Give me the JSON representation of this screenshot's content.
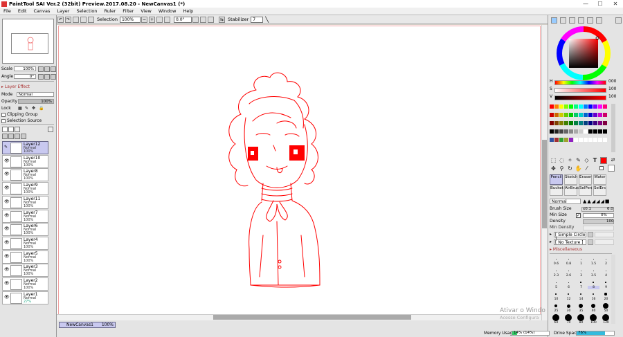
{
  "window": {
    "title": "PaintTool SAI Ver.2 (32bit) Preview.2017.08.20 - NewCanvas1 (*)",
    "minimize_glyph": "—",
    "maximize_glyph": "☐",
    "close_glyph": "✕"
  },
  "menu": [
    "File",
    "Edit",
    "Canvas",
    "Layer",
    "Selection",
    "Ruler",
    "Filter",
    "View",
    "Window",
    "Help"
  ],
  "toolbar": {
    "selection_label": "Selection",
    "zoom_value": "100%",
    "rotation_value": "0.0°",
    "stabilizer_label": "Stabilizer",
    "stabilizer_value": "7"
  },
  "left": {
    "scale_label": "Scale",
    "scale_value": "100%",
    "angle_label": "Angle",
    "angle_value": "0°",
    "layer_effect_label": "Layer Effect",
    "mode_label": "Mode",
    "mode_value": "Normal",
    "opacity_label": "Opacity",
    "opacity_value": "100%",
    "lock_label": "Lock",
    "clipping_label": "Clipping Group",
    "selection_source_label": "Selection Source",
    "layers": [
      {
        "name": "Layer12",
        "mode": "Normal",
        "opacity": "100%",
        "selected": true,
        "visible": false
      },
      {
        "name": "Layer10",
        "mode": "Normal",
        "opacity": "100%",
        "selected": false,
        "visible": true
      },
      {
        "name": "Layer8",
        "mode": "Normal",
        "opacity": "100%",
        "selected": false,
        "visible": true
      },
      {
        "name": "Layer9",
        "mode": "Normal",
        "opacity": "100%",
        "selected": false,
        "visible": true
      },
      {
        "name": "Layer11",
        "mode": "Normal",
        "opacity": "100%",
        "selected": false,
        "visible": true
      },
      {
        "name": "Layer7",
        "mode": "Normal",
        "opacity": "100%",
        "selected": false,
        "visible": true
      },
      {
        "name": "Layer6",
        "mode": "Normal",
        "opacity": "100%",
        "selected": false,
        "visible": true
      },
      {
        "name": "Layer4",
        "mode": "Normal",
        "opacity": "100%",
        "selected": false,
        "visible": true
      },
      {
        "name": "Layer5",
        "mode": "Normal",
        "opacity": "100%",
        "selected": false,
        "visible": true
      },
      {
        "name": "Layer3",
        "mode": "Normal",
        "opacity": "100%",
        "selected": false,
        "visible": true
      },
      {
        "name": "Layer2",
        "mode": "Normal",
        "opacity": "100%",
        "selected": false,
        "visible": true
      },
      {
        "name": "Layer1",
        "mode": "Normal",
        "opacity": "27%",
        "selected": false,
        "visible": true
      }
    ]
  },
  "document_tab": {
    "name": "NewCanvas1",
    "zoom": "100%"
  },
  "color": {
    "current": "#ff0000",
    "h_label": "H",
    "h_value": "000",
    "s_label": "S",
    "s_value": "100",
    "v_label": "V",
    "v_value": "100",
    "swatches": [
      "#ff0000",
      "#ff8000",
      "#ffff00",
      "#80ff00",
      "#00ff00",
      "#00ff80",
      "#00ffff",
      "#0080ff",
      "#0000ff",
      "#8000ff",
      "#ff00ff",
      "#ff0080",
      "#cc0000",
      "#cc6600",
      "#cccc00",
      "#66cc00",
      "#00cc00",
      "#00cc66",
      "#00cccc",
      "#0066cc",
      "#0000cc",
      "#6600cc",
      "#cc00cc",
      "#cc0066",
      "#800000",
      "#804000",
      "#808000",
      "#408000",
      "#008000",
      "#008040",
      "#008080",
      "#004080",
      "#000080",
      "#400080",
      "#800080",
      "#800040",
      "#000000",
      "#222222",
      "#444444",
      "#666666",
      "#888888",
      "#aaaaaa",
      "#cccccc",
      "#ffffff",
      "#000000",
      "#000000",
      "#000000",
      "#000000",
      "#3050a0",
      "#a03030",
      "#30a030",
      "#a0a030",
      "#9020c0",
      "#ffffff",
      "#ffffff",
      "#ffffff",
      "#ffffff",
      "#ffffff",
      "#ffffff",
      "#ffffff"
    ]
  },
  "brushes": {
    "row1": [
      "Pencil",
      "Sketch",
      "Eraser",
      "Water"
    ],
    "row2": [
      "Bucket",
      "AirBrush",
      "SelPen",
      "SelErs"
    ],
    "blend_mode": "Normal",
    "size_label": "Brush Size",
    "size_mult": "x0.1",
    "size_value": "6.0",
    "min_size_label": "Min Size",
    "min_size_value": "0%",
    "density_label": "Density",
    "density_value": "100",
    "min_density_label": "Min Density",
    "shape_value": "[ Simple Circle ]",
    "texture_value": "[ No Texture ]",
    "misc_label": "Miscellaneous",
    "sizes": [
      "0.6",
      "0.8",
      "1",
      "1.5",
      "2",
      "2.3",
      "2.6",
      "3",
      "3.5",
      "4",
      "5",
      "6",
      "7",
      "8",
      "9",
      "10",
      "12",
      "14",
      "16",
      "20",
      "25",
      "30",
      "35",
      "40",
      "50",
      "60",
      "70",
      "80",
      "100",
      "120"
    ]
  },
  "status": {
    "memory_label": "Memory Usage",
    "memory_value": "14% (14%)",
    "memory_fraction": 0.14,
    "drive_label": "Drive Space",
    "drive_value": "76%",
    "drive_fraction": 0.76
  },
  "watermark": {
    "line1": "Ativar o Windo",
    "line2": "Acesse Configura"
  }
}
